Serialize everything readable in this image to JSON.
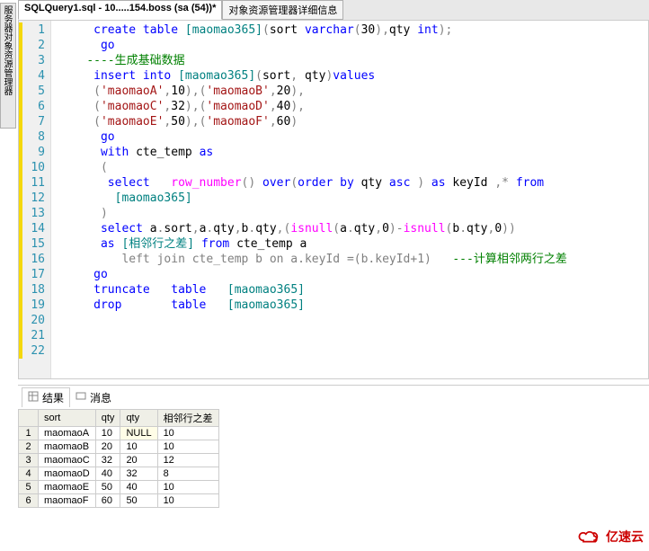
{
  "side_panel": "服务器对象资源管理器",
  "tabs": [
    {
      "label": "SQLQuery1.sql - 10.....154.boss (sa (54))*",
      "active": true
    },
    {
      "label": "对象资源管理器详细信息",
      "active": false
    }
  ],
  "code_lines": [
    {
      "n": 1,
      "frags": [
        [
          "",
          "     "
        ],
        [
          "kw",
          "create table"
        ],
        [
          "",
          " "
        ],
        [
          "obj",
          "[maomao365]"
        ],
        [
          "grey",
          "("
        ],
        [
          "",
          "sort "
        ],
        [
          "kw",
          "varchar"
        ],
        [
          "grey",
          "("
        ],
        [
          "",
          "30"
        ],
        [
          "grey",
          ")"
        ],
        [
          "grey",
          ","
        ],
        [
          "",
          "qty "
        ],
        [
          "kw",
          "int"
        ],
        [
          "grey",
          ")"
        ],
        [
          "grey",
          ";"
        ]
      ]
    },
    {
      "n": 2,
      "frags": [
        [
          "",
          "      "
        ],
        [
          "kw",
          "go"
        ]
      ]
    },
    {
      "n": 3,
      "frags": [
        [
          "",
          "    "
        ],
        [
          "cmt",
          "----生成基础数据"
        ]
      ]
    },
    {
      "n": 4,
      "frags": [
        [
          "",
          "     "
        ],
        [
          "kw",
          "insert into"
        ],
        [
          "",
          " "
        ],
        [
          "obj",
          "[maomao365]"
        ],
        [
          "grey",
          "("
        ],
        [
          "",
          "sort"
        ],
        [
          "grey",
          ","
        ],
        [
          "",
          " qty"
        ],
        [
          "grey",
          ")"
        ],
        [
          "kw",
          "values"
        ]
      ]
    },
    {
      "n": 5,
      "frags": [
        [
          "",
          "     "
        ],
        [
          "grey",
          "("
        ],
        [
          "str",
          "'maomaoA'"
        ],
        [
          "grey",
          ","
        ],
        [
          "",
          "10"
        ],
        [
          "grey",
          ")"
        ],
        [
          "grey",
          ","
        ],
        [
          "grey",
          "("
        ],
        [
          "str",
          "'maomaoB'"
        ],
        [
          "grey",
          ","
        ],
        [
          "",
          "20"
        ],
        [
          "grey",
          ")"
        ],
        [
          "grey",
          ","
        ]
      ]
    },
    {
      "n": 6,
      "frags": [
        [
          "",
          "     "
        ],
        [
          "grey",
          "("
        ],
        [
          "str",
          "'maomaoC'"
        ],
        [
          "grey",
          ","
        ],
        [
          "",
          "32"
        ],
        [
          "grey",
          ")"
        ],
        [
          "grey",
          ","
        ],
        [
          "grey",
          "("
        ],
        [
          "str",
          "'maomaoD'"
        ],
        [
          "grey",
          ","
        ],
        [
          "",
          "40"
        ],
        [
          "grey",
          ")"
        ],
        [
          "grey",
          ","
        ]
      ]
    },
    {
      "n": 7,
      "frags": [
        [
          "",
          "     "
        ],
        [
          "grey",
          "("
        ],
        [
          "str",
          "'maomaoE'"
        ],
        [
          "grey",
          ","
        ],
        [
          "",
          "50"
        ],
        [
          "grey",
          ")"
        ],
        [
          "grey",
          ","
        ],
        [
          "grey",
          "("
        ],
        [
          "str",
          "'maomaoF'"
        ],
        [
          "grey",
          ","
        ],
        [
          "",
          "60"
        ],
        [
          "grey",
          ")"
        ]
      ]
    },
    {
      "n": 8,
      "frags": [
        [
          "",
          "      "
        ],
        [
          "kw",
          "go"
        ]
      ]
    },
    {
      "n": 9,
      "frags": [
        [
          "",
          ""
        ]
      ]
    },
    {
      "n": 10,
      "frags": [
        [
          "",
          "      "
        ],
        [
          "kw",
          "with"
        ],
        [
          "",
          " cte_temp "
        ],
        [
          "kw",
          "as"
        ]
      ]
    },
    {
      "n": 11,
      "frags": [
        [
          "",
          "      "
        ],
        [
          "grey",
          "("
        ]
      ]
    },
    {
      "n": 12,
      "frags": [
        [
          "",
          "       "
        ],
        [
          "kw",
          "select"
        ],
        [
          "",
          "   "
        ],
        [
          "fn",
          "row_number"
        ],
        [
          "grey",
          "()"
        ],
        [
          "",
          " "
        ],
        [
          "kw",
          "over"
        ],
        [
          "grey",
          "("
        ],
        [
          "kw",
          "order by"
        ],
        [
          "",
          " qty "
        ],
        [
          "kw",
          "asc"
        ],
        [
          "",
          " "
        ],
        [
          "grey",
          ")"
        ],
        [
          "",
          " "
        ],
        [
          "kw",
          "as"
        ],
        [
          "",
          " keyId "
        ],
        [
          "grey",
          ","
        ],
        [
          "grey",
          "*"
        ],
        [
          "",
          " "
        ],
        [
          "kw",
          "from"
        ]
      ]
    },
    {
      "n": 13,
      "frags": [
        [
          "",
          "        "
        ],
        [
          "obj",
          "[maomao365]"
        ]
      ]
    },
    {
      "n": 14,
      "frags": [
        [
          "",
          "      "
        ],
        [
          "grey",
          ")"
        ]
      ]
    },
    {
      "n": 15,
      "frags": [
        [
          "",
          ""
        ]
      ]
    },
    {
      "n": 16,
      "frags": [
        [
          "",
          "      "
        ],
        [
          "kw",
          "select"
        ],
        [
          "",
          " a"
        ],
        [
          "grey",
          "."
        ],
        [
          "",
          "sort"
        ],
        [
          "grey",
          ","
        ],
        [
          "",
          "a"
        ],
        [
          "grey",
          "."
        ],
        [
          "",
          "qty"
        ],
        [
          "grey",
          ","
        ],
        [
          "",
          "b"
        ],
        [
          "grey",
          "."
        ],
        [
          "",
          "qty"
        ],
        [
          "grey",
          ","
        ],
        [
          "grey",
          "("
        ],
        [
          "fn",
          "isnull"
        ],
        [
          "grey",
          "("
        ],
        [
          "",
          "a"
        ],
        [
          "grey",
          "."
        ],
        [
          "",
          "qty"
        ],
        [
          "grey",
          ","
        ],
        [
          "",
          "0"
        ],
        [
          "grey",
          ")"
        ],
        [
          "grey",
          "-"
        ],
        [
          "fn",
          "isnull"
        ],
        [
          "grey",
          "("
        ],
        [
          "",
          "b"
        ],
        [
          "grey",
          "."
        ],
        [
          "",
          "qty"
        ],
        [
          "grey",
          ","
        ],
        [
          "",
          "0"
        ],
        [
          "grey",
          "))"
        ]
      ]
    },
    {
      "n": 17,
      "frags": [
        [
          "",
          "      "
        ],
        [
          "kw",
          "as"
        ],
        [
          "",
          " "
        ],
        [
          "obj",
          "[相邻行之差]"
        ],
        [
          "",
          " "
        ],
        [
          "kw",
          "from"
        ],
        [
          "",
          " cte_temp a"
        ]
      ]
    },
    {
      "n": 18,
      "frags": [
        [
          "",
          "         "
        ],
        [
          "grey",
          "left join"
        ],
        [
          "grey",
          " cte_temp b "
        ],
        [
          "grey",
          "on"
        ],
        [
          "grey",
          " a"
        ],
        [
          "grey",
          "."
        ],
        [
          "grey",
          "keyId "
        ],
        [
          "grey",
          "="
        ],
        [
          "grey",
          "("
        ],
        [
          "grey",
          "b"
        ],
        [
          "grey",
          "."
        ],
        [
          "grey",
          "keyId"
        ],
        [
          "grey",
          "+"
        ],
        [
          "grey",
          "1"
        ],
        [
          "grey",
          ")"
        ],
        [
          "",
          "   "
        ],
        [
          "cmt",
          "---计算相邻两行之差"
        ]
      ]
    },
    {
      "n": 19,
      "frags": [
        [
          "",
          ""
        ]
      ]
    },
    {
      "n": 20,
      "frags": [
        [
          "",
          "     "
        ],
        [
          "kw",
          "go"
        ]
      ]
    },
    {
      "n": 21,
      "frags": [
        [
          "",
          "     "
        ],
        [
          "kw",
          "truncate"
        ],
        [
          "",
          "   "
        ],
        [
          "kw",
          "table"
        ],
        [
          "",
          "   "
        ],
        [
          "obj",
          "[maomao365]"
        ]
      ]
    },
    {
      "n": 22,
      "frags": [
        [
          "",
          "     "
        ],
        [
          "kw",
          "drop"
        ],
        [
          "",
          "       "
        ],
        [
          "kw",
          "table"
        ],
        [
          "",
          "   "
        ],
        [
          "obj",
          "[maomao365]"
        ]
      ]
    }
  ],
  "result_tabs": [
    {
      "label": "结果",
      "active": true
    },
    {
      "label": "消息",
      "active": false
    }
  ],
  "result_columns": [
    "",
    "sort",
    "qty",
    "qty",
    "相邻行之差"
  ],
  "result_rows": [
    [
      "1",
      "maomaoA",
      "10",
      "NULL",
      "10"
    ],
    [
      "2",
      "maomaoB",
      "20",
      "10",
      "10"
    ],
    [
      "3",
      "maomaoC",
      "32",
      "20",
      "12"
    ],
    [
      "4",
      "maomaoD",
      "40",
      "32",
      "8"
    ],
    [
      "5",
      "maomaoE",
      "50",
      "40",
      "10"
    ],
    [
      "6",
      "maomaoF",
      "60",
      "50",
      "10"
    ]
  ],
  "watermark": "亿速云"
}
